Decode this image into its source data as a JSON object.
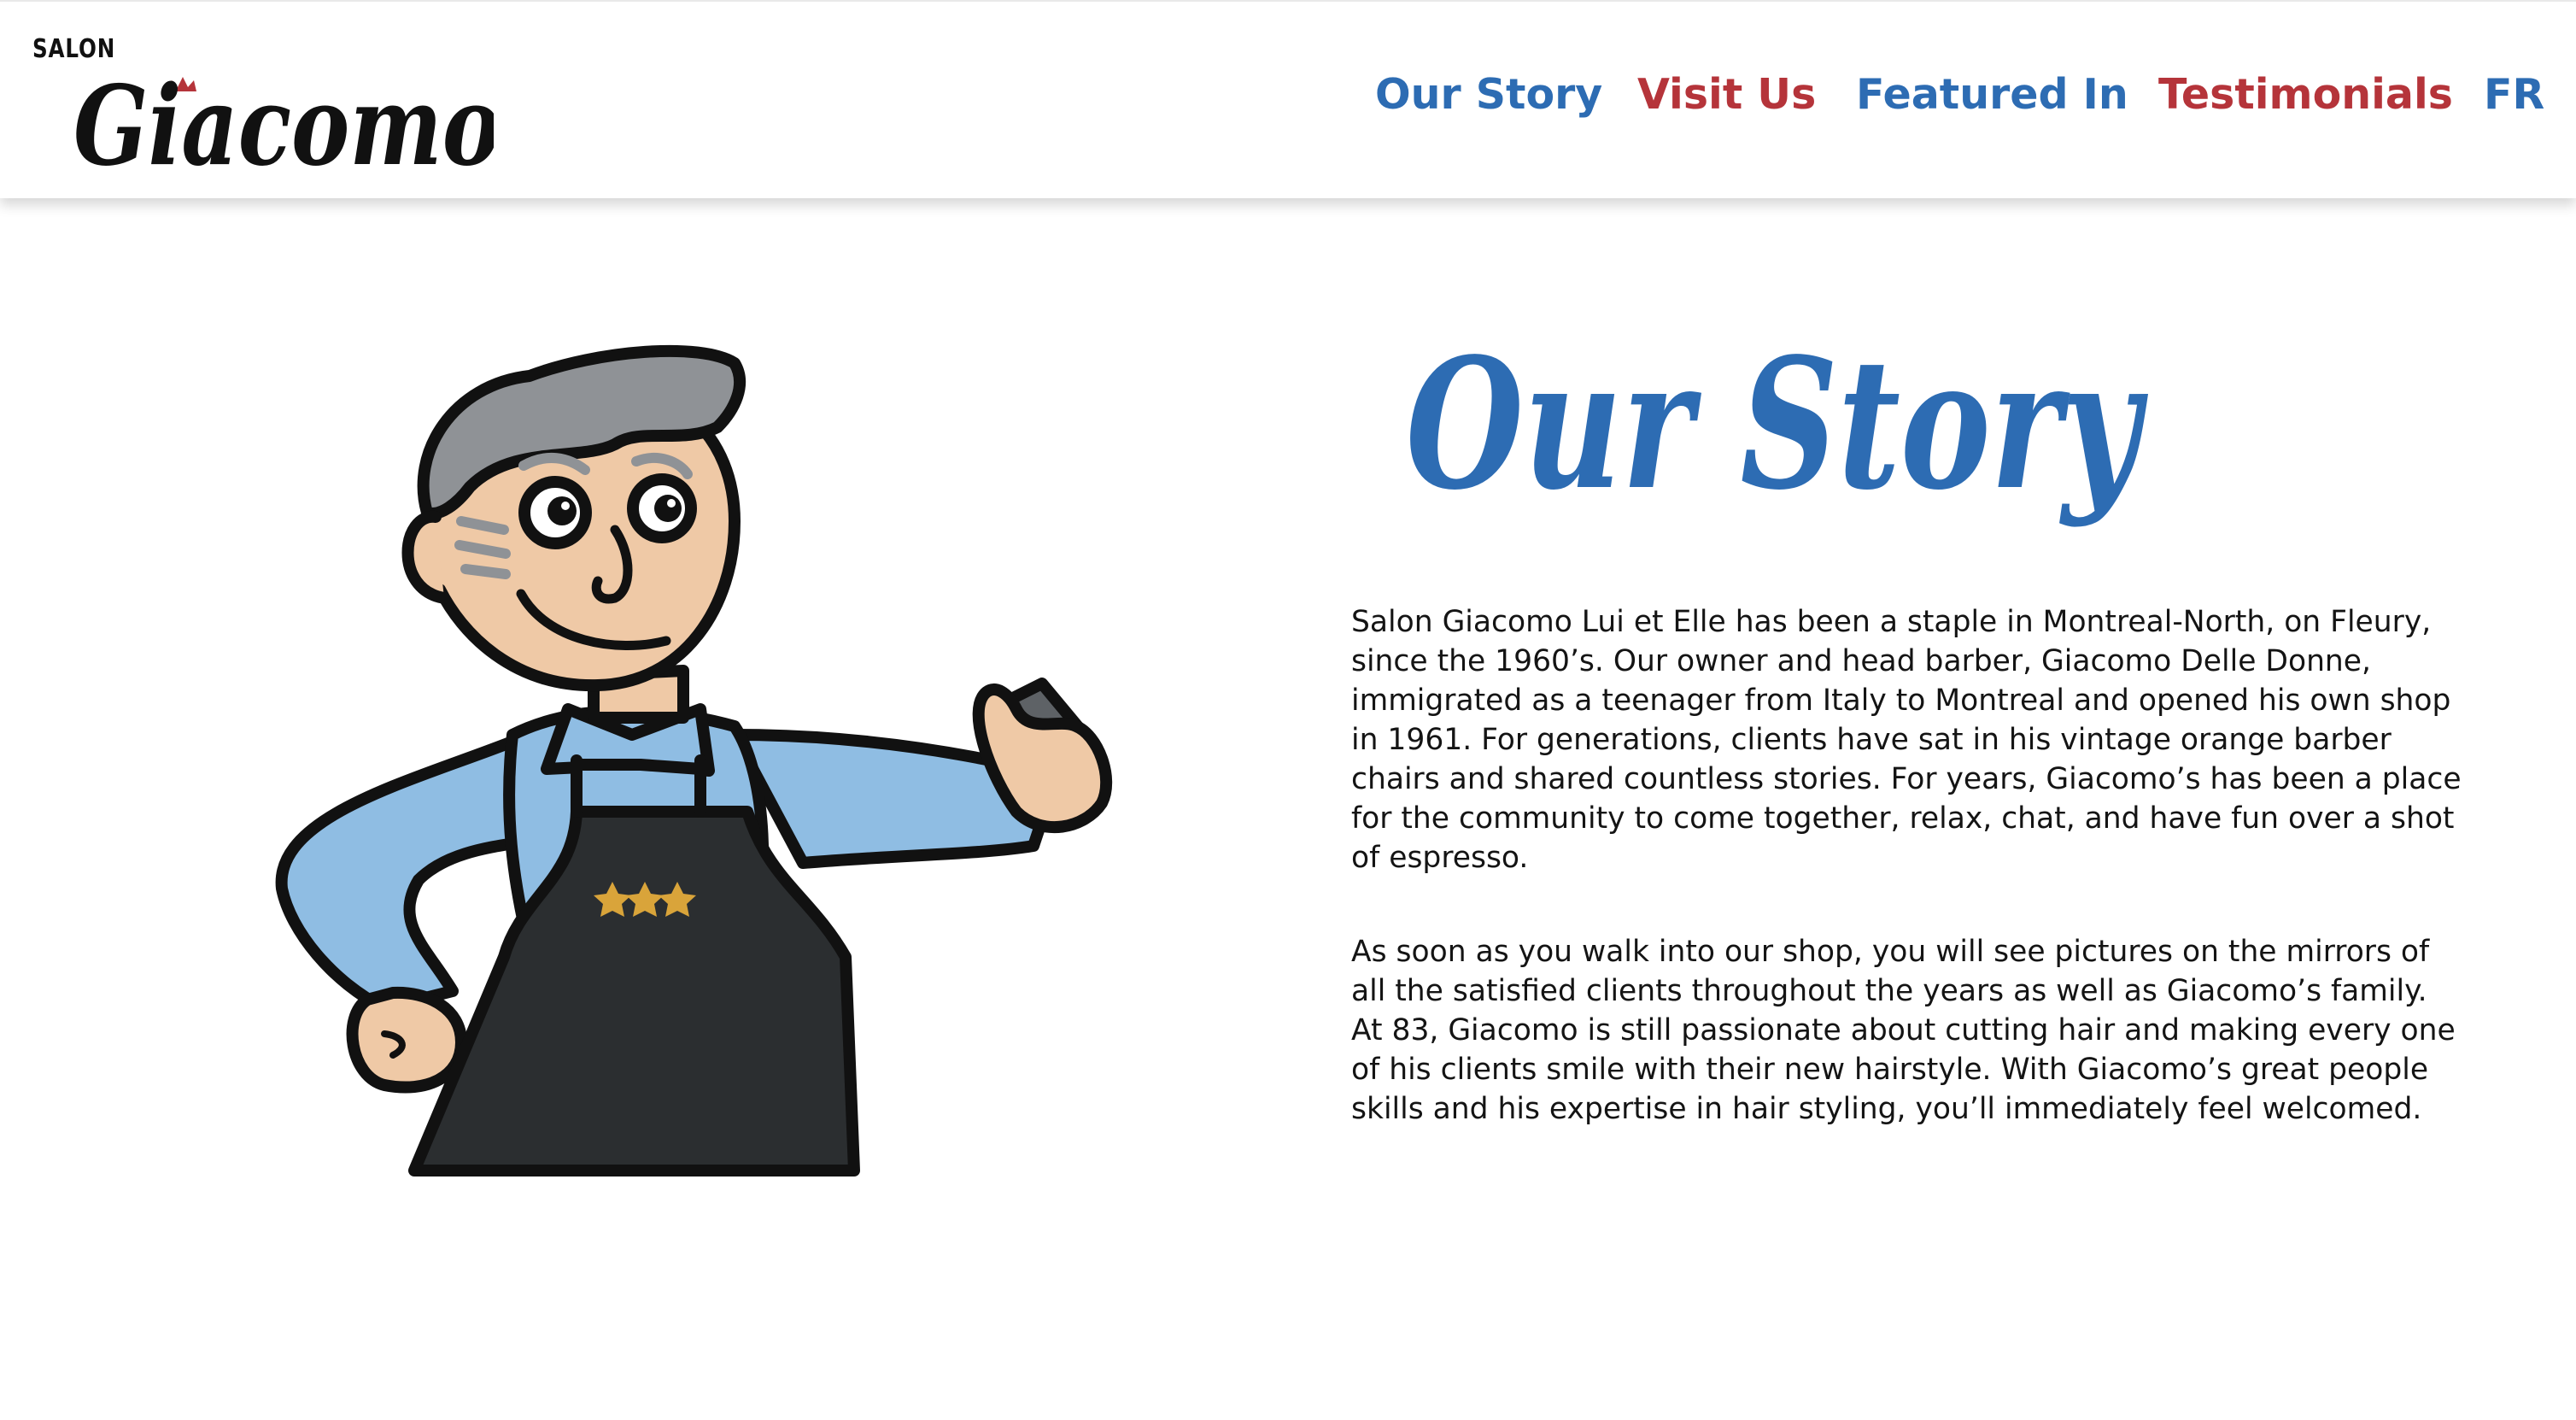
{
  "brand": {
    "small_label": "SALON",
    "name": "Giacomo"
  },
  "nav": {
    "items": [
      {
        "label": "Our Story",
        "color": "#2d6cb3"
      },
      {
        "label": "Visit Us",
        "color": "#b5343a"
      },
      {
        "label": "Featured In",
        "color": "#2d6cb3"
      },
      {
        "label": "Testimonials",
        "color": "#b5343a"
      },
      {
        "label": "FR",
        "color": "#2d6cb3"
      }
    ]
  },
  "main": {
    "title": "Our Story",
    "paragraphs": [
      "Salon Giacomo Lui et Elle has been a staple in Montreal-North, on Fleury, since the 1960’s. Our owner and head barber, Giacomo Delle Donne, immigrated as a teenager from Italy to Montreal and opened his own shop in 1961. For generations, clients have sat in his vintage orange barber chairs and shared countless stories. For years, Giacomo’s has been a place for the community to come together, relax, chat, and have fun over a shot of espresso.",
      "As soon as you walk into our shop, you will see pictures on the mirrors of all the satisfied clients throughout the years as well as Giacomo’s family. At 83, Giacomo is still passionate about cutting hair and making every one of his clients smile with their new hairstyle. With Giacomo’s great people skills and his expertise in hair styling, you’ll immediately feel welcomed."
    ],
    "illustration_icon": "barber-mascot-illustration"
  },
  "colors": {
    "blue": "#2d6cb3",
    "red": "#b5343a",
    "text": "#141414",
    "shirt": "#8fbde3",
    "apron": "#2b2e30",
    "skin": "#efc9a6",
    "hair": "#8f9296",
    "stars": "#d9a43a"
  }
}
